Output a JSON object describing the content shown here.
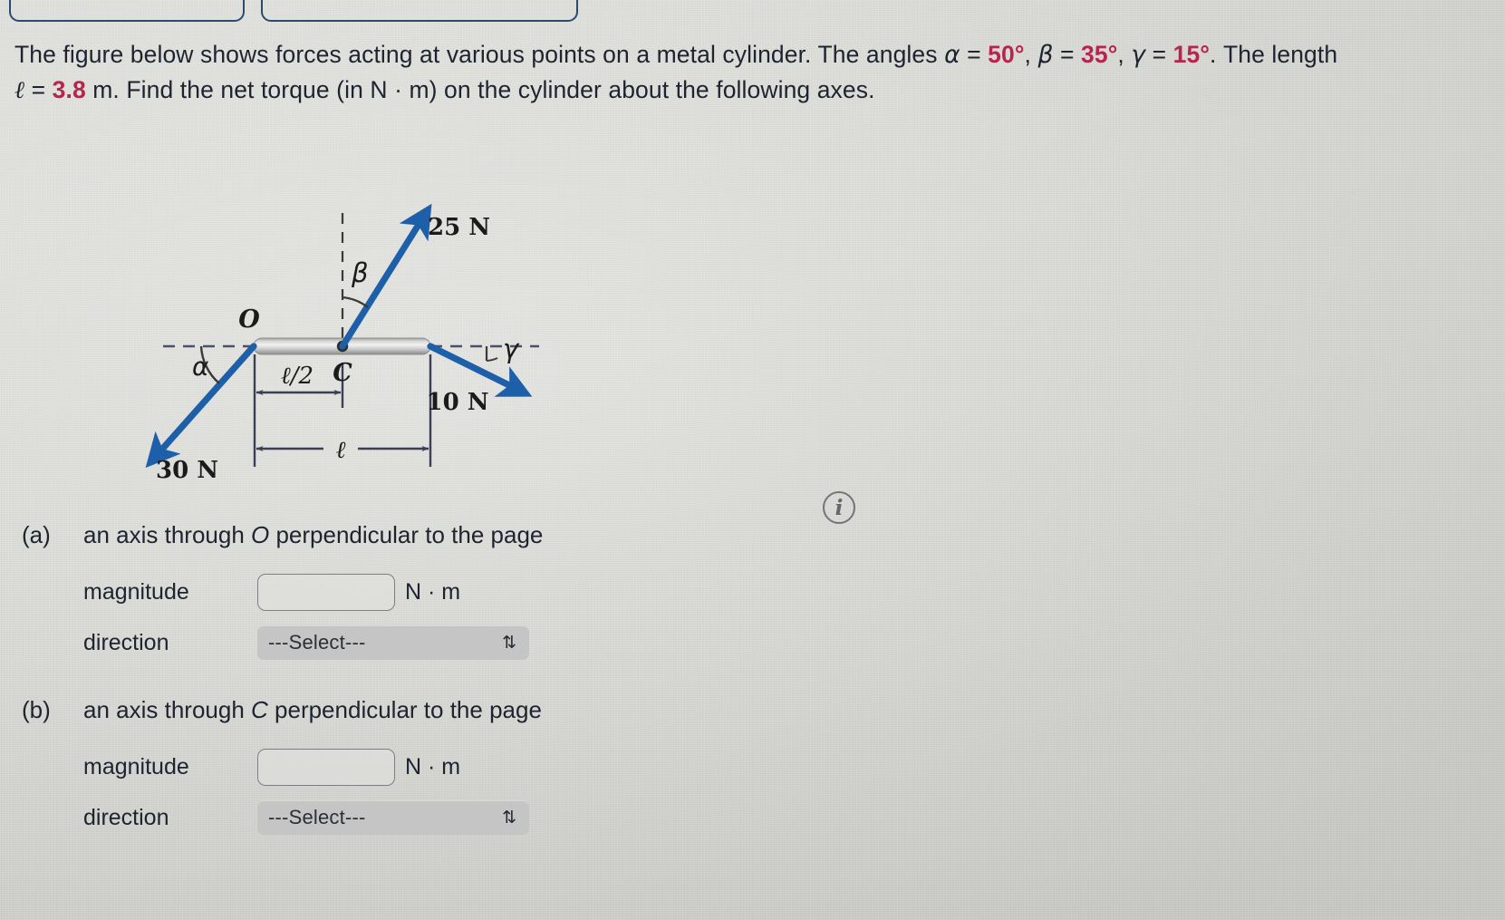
{
  "top_boxes": [
    {
      "name": "cropped-box-left"
    },
    {
      "name": "cropped-box-right"
    }
  ],
  "statement": {
    "part1": "The figure below shows forces acting at various points on a metal cylinder. The angles ",
    "alpha_symbol": "α",
    "alpha_eq": " = ",
    "alpha_value": "50°",
    "sep1": ", ",
    "beta_symbol": "β",
    "beta_eq": " = ",
    "beta_value": "35°",
    "sep2": ", ",
    "gamma_symbol": "γ",
    "gamma_eq": " = ",
    "gamma_value": "15°",
    "part2": ". The length ",
    "ell_symbol": "ℓ",
    "ell_eq": " = ",
    "ell_value": "3.8",
    "part3": " m. Find the net torque (in N · m) on the cylinder about the following axes."
  },
  "figure": {
    "point_o_label": "O",
    "point_c_label": "C",
    "alpha_label": "α",
    "beta_label": "β",
    "gamma_label": "γ",
    "force_25_label": "25 N",
    "force_10_label": "10 N",
    "force_30_label": "30 N",
    "dim_half_label": "ℓ/2",
    "dim_full_label": "ℓ",
    "colors": {
      "arrow": "#1d5fa8",
      "cylinder_light": "#e9e9e9",
      "cylinder_mid": "#c3c3c3",
      "cylinder_dark": "#8e8e8e",
      "dashed": "#4a4f6a",
      "dimension": "#3b3f55",
      "label_text": "#1b1b1b"
    }
  },
  "info_icon": {
    "glyph": "i",
    "name": "info-icon"
  },
  "parts": [
    {
      "letter": "(a)",
      "text_pre": "an axis through ",
      "axis_point": "O",
      "text_post": " perpendicular to the page",
      "magnitude_label": "magnitude",
      "magnitude_value": "",
      "magnitude_placeholder": "",
      "unit": "N · m",
      "direction_label": "direction",
      "direction_value": "---Select---",
      "chevron": "⇅"
    },
    {
      "letter": "(b)",
      "text_pre": "an axis through ",
      "axis_point": "C",
      "text_post": " perpendicular to the page",
      "magnitude_label": "magnitude",
      "magnitude_value": "",
      "magnitude_placeholder": "",
      "unit": "N · m",
      "direction_label": "direction",
      "direction_value": "---Select---",
      "chevron": "⇅"
    }
  ]
}
